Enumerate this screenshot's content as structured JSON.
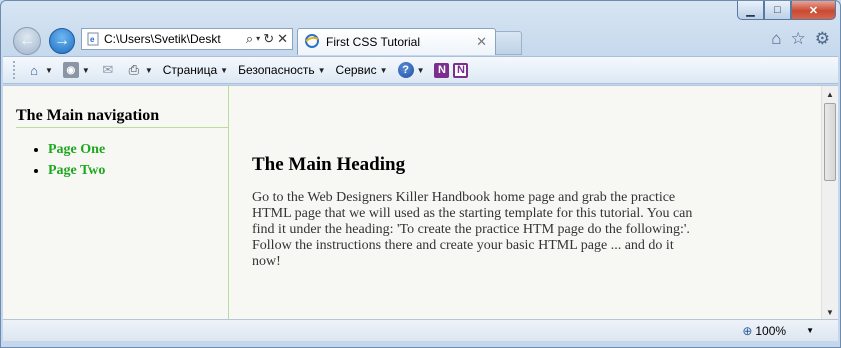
{
  "window": {
    "controls": {
      "minimize": "▁",
      "maximize": "□",
      "close": "✕"
    }
  },
  "address_bar": {
    "value": "C:\\Users\\Svetik\\Deskt"
  },
  "tab": {
    "title": "First CSS Tutorial",
    "close": "✕"
  },
  "command_bar": {
    "page_menu": "Страница",
    "safety_menu": "Безопасность",
    "tools_menu": "Сервис",
    "onenote_label": "N"
  },
  "page": {
    "nav_heading": "The Main navigation",
    "nav_links": [
      "Page One",
      "Page Two"
    ],
    "main_heading": "The Main Heading",
    "main_paragraph": "Go to the Web Designers Killer Handbook home page and grab the practice HTML page that we will used as the starting template for this tutorial. You can find it under the heading: 'To create the practice HTM page do the following:'. Follow the instructions there and create your basic HTML page ... and do it now!"
  },
  "status_bar": {
    "zoom": "100%"
  },
  "colors": {
    "link": "#1ea81e",
    "sidebar_border": "#b9dc9f"
  },
  "icons": [
    "back-icon",
    "forward-icon",
    "search-icon",
    "refresh-icon",
    "stop-icon",
    "home-icon",
    "favorites-icon",
    "gear-icon",
    "rss-icon",
    "mail-icon",
    "print-icon",
    "help-icon",
    "onenote-icon",
    "zoom-icon"
  ]
}
